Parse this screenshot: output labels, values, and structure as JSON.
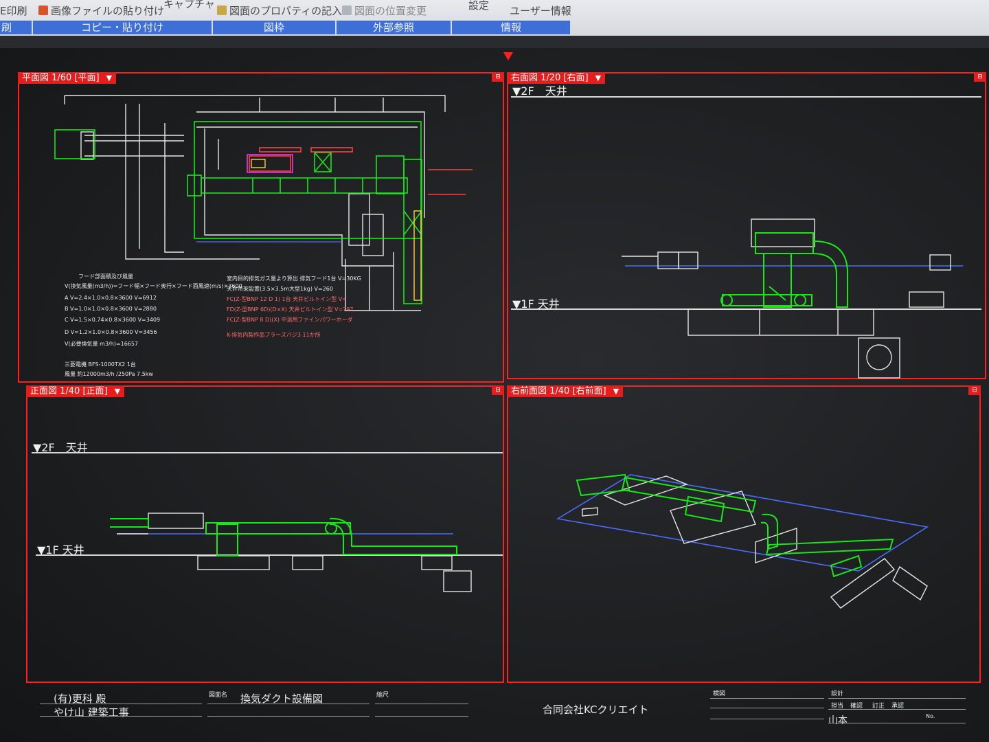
{
  "ribbon": {
    "buttons": [
      {
        "label": "E印刷",
        "dim": false
      },
      {
        "label": "画像ファイルの貼り付け",
        "dim": false
      },
      {
        "label": "キャプチャ",
        "dim": false
      },
      {
        "label": "図面のプロパティの記入",
        "dim": false
      },
      {
        "label": "図面の位置変更",
        "dim": true
      },
      {
        "label": "設定",
        "dim": false
      },
      {
        "label": "ユーザー情報",
        "dim": false
      }
    ],
    "groups": [
      "刷",
      "コピー・貼り付け",
      "図枠",
      "外部参照",
      "情報"
    ]
  },
  "viewports": {
    "plan": {
      "title": "平面図 1/60 [平面]",
      "arrow": "▼"
    },
    "right": {
      "title": "右面図 1/20 [右面]",
      "arrow": "▼"
    },
    "front": {
      "title": "正面図 1/40 [正面]",
      "arrow": "▼"
    },
    "iso": {
      "title": "右前面図 1/40 [右前面]",
      "arrow": "▼"
    }
  },
  "levels": {
    "right_2f": "▼2F　天井",
    "right_1f": "▼1F 天井",
    "front_2f": "▼2F　天井",
    "front_1f": "▼1F 天井"
  },
  "plan_notes": {
    "left": [
      "フード部面積及び風量",
      "V(換気風量(m3/h))=フード幅×フード奥行×フード面風速(m/s)×3600",
      "A  V=2.4×1.0×0.8×3600        V=6912",
      "B  V=1.0×1.0×0.8×3600        V=2880",
      "C  V=1.5×0.74×0.8×3600       V=3409",
      "D  V=1.2×1.0×0.8×3600        V=3456",
      "V(必要換気量 m3/h)=16657",
      "三菱電機 BFS-1000TX2   1台",
      "風量  約12000m3/h /250Pa 7.5kw"
    ],
    "right": [
      "室内目的排気ガス量より算出  排気フード1台  V=30KG",
      "天井吊架設置(3.5×3.5m大型1kg)      V=260",
      "FC(Z-型BNP 12 D 1)  1台  天井ビルトイン型     V=",
      "FD(Z-型BNP 6D)(D×X) 天井ビルトイン型   V=797",
      "FC(Z-型BNP 8 D)(X) 中温用ファインパワーホーダ",
      "K-排気内製作品ブラーズバジ3  11か所"
    ]
  },
  "title_block": {
    "client": "(有)更科 殿",
    "project": "やけ山 建築工事",
    "drawing_name_label": "図面名",
    "drawing_name": "換気ダクト設備図",
    "scale_label": "縮尺",
    "company": "合同会社KCクリエイト",
    "inspect_label": "検図",
    "design_label": "設計",
    "design_sub": [
      "担当",
      "確認",
      "訂正",
      "承認"
    ],
    "designer": "山本",
    "no_label": "No."
  },
  "colors": {
    "viewport_border": "#ff2020",
    "duct_green": "#18e818",
    "outline_white": "#e6e6e6",
    "ref_blue": "#4a6cff",
    "accent_red": "#ff3030",
    "ribbon_group": "#3d6fd6"
  }
}
